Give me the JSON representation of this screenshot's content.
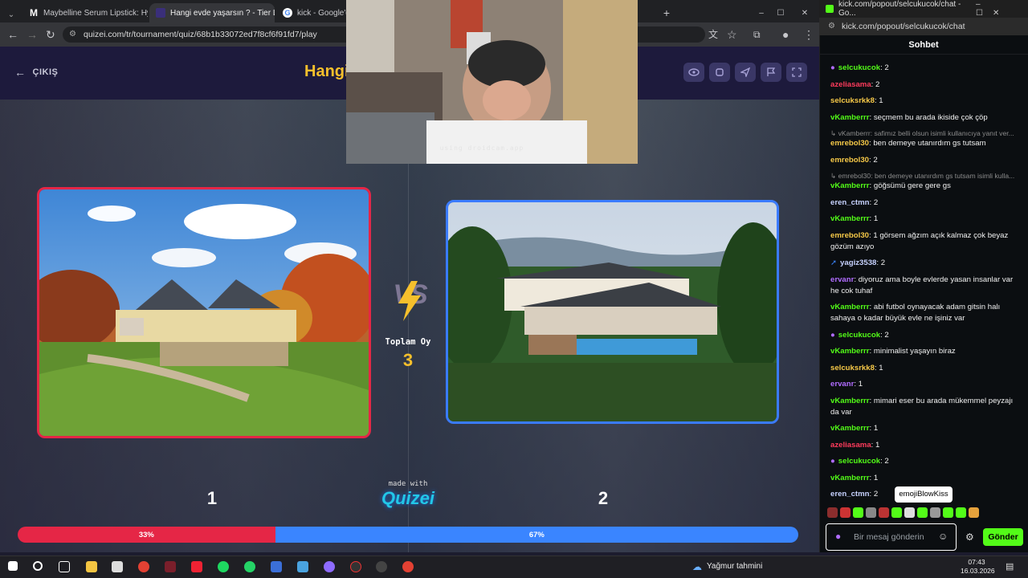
{
  "browser": {
    "tabs": [
      {
        "label": "Maybelline Serum Lipstick: Hya",
        "icon": "maybelline-m-icon"
      },
      {
        "label": "Hangi evde yaşarsın ? - Tier Lis",
        "icon": "quizei-icon"
      },
      {
        "label": "kick - Google'da A",
        "icon": "google-icon"
      }
    ],
    "url": "quizei.com/tr/tournament/quiz/68b1b33072ed7f8cf6f91fd7/play"
  },
  "quiz": {
    "exit_label": "ÇIKIŞ",
    "title": "Hangi",
    "vs_label": "VS",
    "total_votes_label": "Toplam Oy",
    "total_votes": "3",
    "option1_number": "1",
    "option2_number": "2",
    "made_with": "made with",
    "brand": "Quizei",
    "option1_percent": "33%",
    "option2_percent": "67%",
    "option1_share": 0.33,
    "option2_share": 0.67,
    "colors": {
      "option1": "#e52646",
      "option2": "#3a85ff",
      "title": "#f6c02c"
    }
  },
  "webcam": {
    "caption": "using droidcam.app"
  },
  "chat": {
    "window_title": "kick.com/popout/selcukucok/chat - Go...",
    "url": "kick.com/popout/selcukucok/chat",
    "header": "Sohbet",
    "messages": [
      {
        "user": "selcukucok",
        "color": "#53fc18",
        "text": "2",
        "badge": "mic"
      },
      {
        "user": "azeliasama",
        "color": "#ff3b5c",
        "text": "2"
      },
      {
        "user": "selcuksrkk8",
        "color": "#f7c948",
        "text": "1"
      },
      {
        "user": "vKamberrr",
        "color": "#53fc18",
        "text": "seçmem bu arada ikiside çok çöp"
      },
      {
        "reply": "↳ vKamberrr: safimız belli olsun isimli kullanıcıya yanıt ver..."
      },
      {
        "user": "emrebol30",
        "color": "#f7c948",
        "text": "ben demeye utanırdım gs tutsam"
      },
      {
        "user": "emrebol30",
        "color": "#f7c948",
        "text": "2"
      },
      {
        "reply": "↳ emrebol30: ben demeye utanırdım gs tutsam isimli kulla..."
      },
      {
        "user": "vKamberrr",
        "color": "#53fc18",
        "text": "göğsümü gere gere gs"
      },
      {
        "user": "eren_ctmn",
        "color": "#c7d2ff",
        "text": "2"
      },
      {
        "user": "vKamberrr",
        "color": "#53fc18",
        "text": "1"
      },
      {
        "user": "emrebol30",
        "color": "#f7c948",
        "text": "1 görsem ağzım açık kalmaz çok beyaz gözüm azıyo"
      },
      {
        "user": "yagiz3538",
        "color": "#c7d2ff",
        "text": "2",
        "badge": "arrow"
      },
      {
        "user": "ervanr",
        "color": "#b06cff",
        "text": "diyoruz ama boyle evlerde yasan insanlar var he cok tuhaf"
      },
      {
        "user": "vKamberrr",
        "color": "#53fc18",
        "text": "abi futbol oynayacak adam gitsin halı sahaya o kadar büyük evle ne işiniz var"
      },
      {
        "user": "selcukucok",
        "color": "#53fc18",
        "text": "2",
        "badge": "mic"
      },
      {
        "user": "vKamberrr",
        "color": "#53fc18",
        "text": "minimalist yaşayın biraz"
      },
      {
        "user": "selcuksrkk8",
        "color": "#f7c948",
        "text": "1"
      },
      {
        "user": "ervanr",
        "color": "#b06cff",
        "text": "1"
      },
      {
        "user": "vKamberrr",
        "color": "#53fc18",
        "text": "mimari eser bu arada mükemmel peyzajı da var"
      },
      {
        "user": "vKamberrr",
        "color": "#53fc18",
        "text": "1"
      },
      {
        "user": "azeliasama",
        "color": "#ff3b5c",
        "text": "1"
      },
      {
        "user": "selcukucok",
        "color": "#53fc18",
        "text": "2",
        "badge": "mic"
      },
      {
        "user": "vKamberrr",
        "color": "#53fc18",
        "text": "1"
      },
      {
        "user": "eren_ctmn",
        "color": "#c7d2ff",
        "text": "2"
      }
    ],
    "tooltip": "emojiBlowKiss",
    "input_placeholder": "Bir mesaj gönderin",
    "send_label": "Gönder"
  },
  "taskbar": {
    "weather": "Yağmur tahmini",
    "time": "07:43",
    "date": "16.03.2026"
  }
}
